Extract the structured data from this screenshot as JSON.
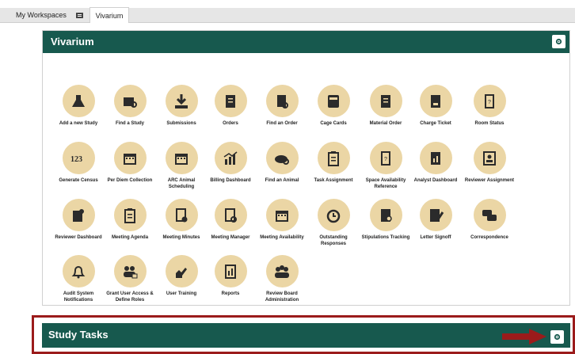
{
  "tabs": {
    "workspaces": "My Workspaces",
    "active": "Vivarium"
  },
  "vivarium_panel": {
    "title": "Vivarium"
  },
  "tiles": [
    {
      "label": "Add a new Study",
      "icon": "flask-icon"
    },
    {
      "label": "Find a Study",
      "icon": "find-folder-icon"
    },
    {
      "label": "Submissions",
      "icon": "download-icon"
    },
    {
      "label": "Orders",
      "icon": "documents-icon"
    },
    {
      "label": "Find an Order",
      "icon": "find-document-icon"
    },
    {
      "label": "Cage Cards",
      "icon": "card-icon"
    },
    {
      "label": "Material Order",
      "icon": "documents-icon"
    },
    {
      "label": "Charge Ticket",
      "icon": "ticket-icon"
    },
    {
      "label": "Room Status",
      "icon": "door-icon"
    },
    {
      "label": "Generate Census",
      "icon": "numbers-icon"
    },
    {
      "label": "Per Diem Collection",
      "icon": "calendar-icon"
    },
    {
      "label": "ARC Animal Scheduling",
      "icon": "calendar-icon"
    },
    {
      "label": "Billing Dashboard",
      "icon": "chart-icon"
    },
    {
      "label": "Find an Animal",
      "icon": "mouse-icon"
    },
    {
      "label": "Task Assignment",
      "icon": "clipboard-icon"
    },
    {
      "label": "Space Availability Reference",
      "icon": "door-icon"
    },
    {
      "label": "Analyst Dashboard",
      "icon": "analyst-icon"
    },
    {
      "label": "Reviewer Assignment",
      "icon": "badge-icon"
    },
    {
      "label": "Reviewer Dashboard",
      "icon": "reviewer-icon"
    },
    {
      "label": "Meeting Agenda",
      "icon": "clipboard-icon"
    },
    {
      "label": "Meeting Minutes",
      "icon": "minutes-icon"
    },
    {
      "label": "Meeting Manager",
      "icon": "manager-icon"
    },
    {
      "label": "Meeting Availability",
      "icon": "calendar-icon"
    },
    {
      "label": "Outstanding Responses",
      "icon": "alarm-icon"
    },
    {
      "label": "Stipulations Tracking",
      "icon": "tracking-icon"
    },
    {
      "label": "Letter Signoff",
      "icon": "pen-icon"
    },
    {
      "label": "Correspondence",
      "icon": "chat-icon"
    },
    {
      "label": "Audit System Notifications",
      "icon": "bell-icon"
    },
    {
      "label": "Grant User Access & Define Roles",
      "icon": "users-lock-icon"
    },
    {
      "label": "User Training",
      "icon": "training-icon"
    },
    {
      "label": "Reports",
      "icon": "report-icon"
    },
    {
      "label": "Review Board Administration",
      "icon": "group-icon"
    }
  ],
  "study_tasks_panel": {
    "title": "Study Tasks"
  },
  "colors": {
    "header": "#17594e",
    "tile_circle": "#ebd6a5",
    "icon": "#2b2b2b",
    "highlight": "#9b1b1b"
  }
}
